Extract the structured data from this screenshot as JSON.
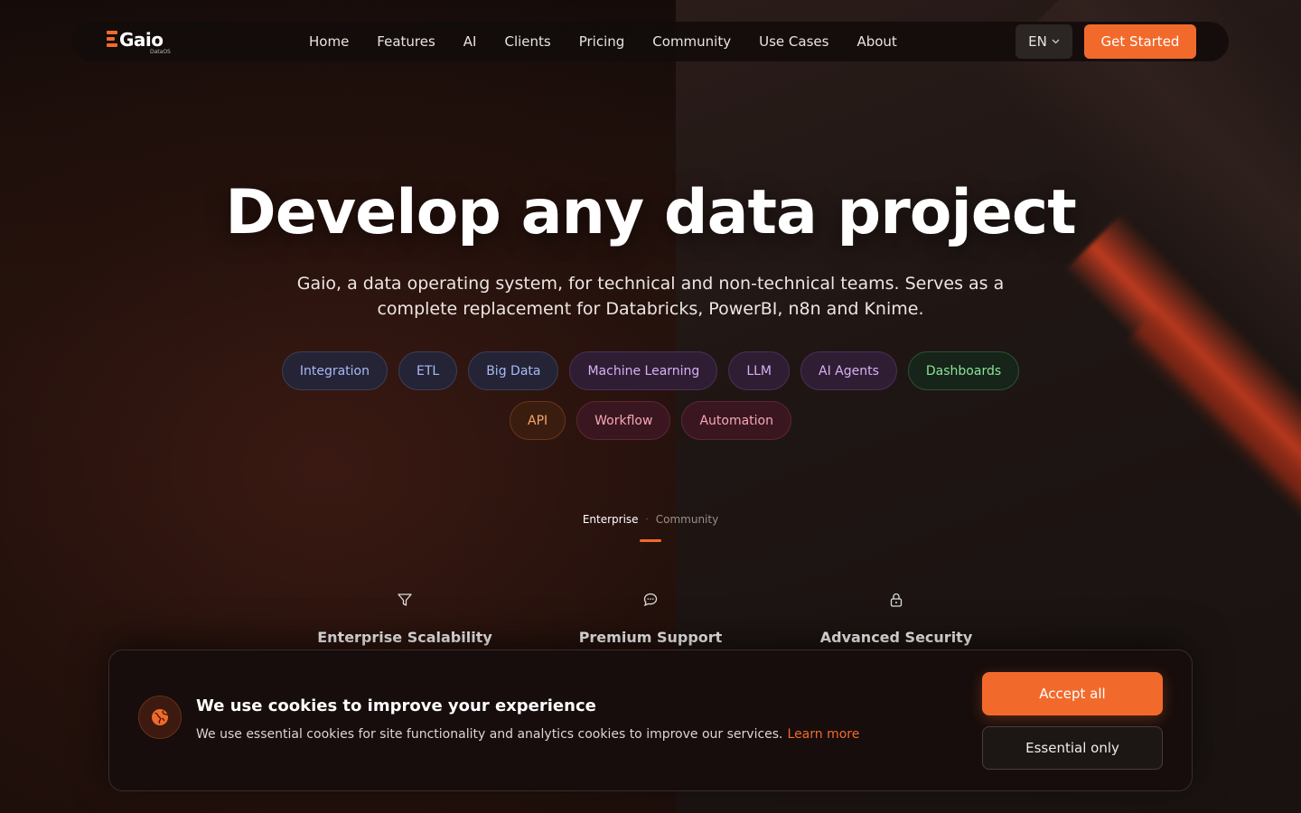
{
  "brand": {
    "name": "Gaio",
    "sub": "DataOS",
    "accent": "#f26a2b"
  },
  "nav": {
    "links": [
      "Home",
      "Features",
      "AI",
      "Clients",
      "Pricing",
      "Community",
      "Use Cases",
      "About"
    ],
    "language": "EN",
    "cta": "Get Started"
  },
  "hero": {
    "title": "Develop any data project",
    "subtitle": "Gaio, a data operating system, for technical and non-technical teams. Serves as a complete replacement for Databricks, PowerBI, n8n and Knime.",
    "tags_row1": [
      {
        "label": "Integration",
        "color": "blue"
      },
      {
        "label": "ETL",
        "color": "blue"
      },
      {
        "label": "Big Data",
        "color": "blue"
      },
      {
        "label": "Machine Learning",
        "color": "purple"
      },
      {
        "label": "LLM",
        "color": "purple"
      },
      {
        "label": "AI Agents",
        "color": "purple"
      },
      {
        "label": "Dashboards",
        "color": "green"
      }
    ],
    "tags_row2": [
      {
        "label": "API",
        "color": "orange"
      },
      {
        "label": "Workflow",
        "color": "pink"
      },
      {
        "label": "Automation",
        "color": "pink"
      }
    ]
  },
  "edition": {
    "active": "Enterprise",
    "inactive": "Community"
  },
  "features": [
    {
      "label": "Enterprise Scalability",
      "icon": "funnel-icon"
    },
    {
      "label": "Premium Support",
      "icon": "chat-bubble-icon"
    },
    {
      "label": "Advanced Security",
      "icon": "lock-icon"
    }
  ],
  "cookie": {
    "title": "We use cookies to improve your experience",
    "text": "We use essential cookies for site functionality and analytics cookies to improve our services.",
    "learn_more": "Learn more",
    "accept": "Accept all",
    "essential": "Essential only",
    "icon": "globe-icon"
  }
}
